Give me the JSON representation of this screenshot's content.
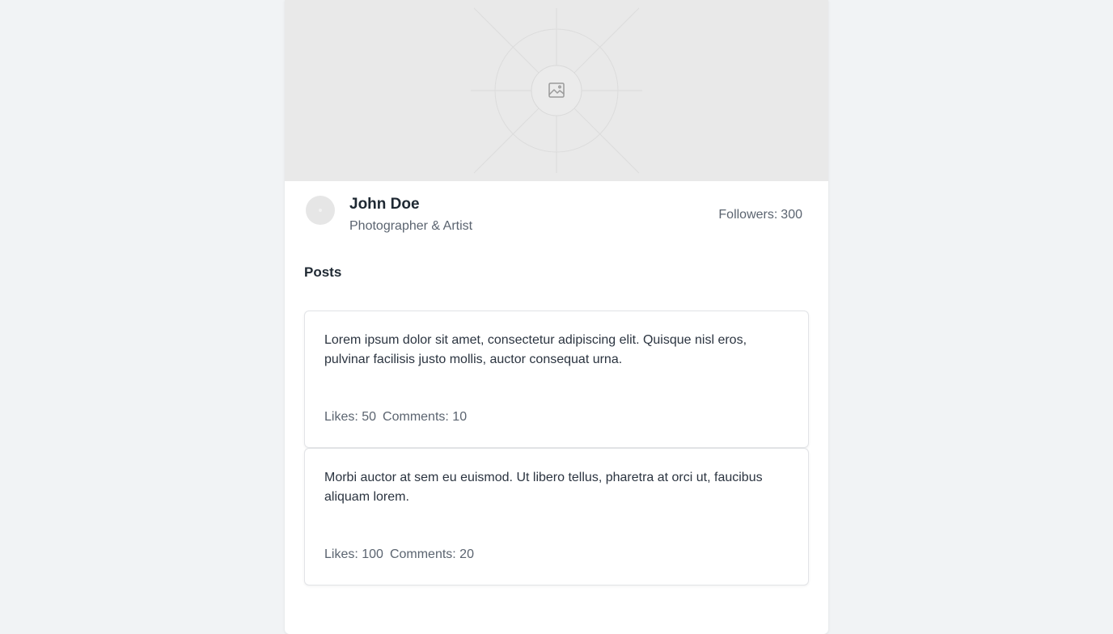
{
  "profile": {
    "name": "John Doe",
    "bio": "Photographer & Artist",
    "followers_label": "Followers:",
    "followers_count": "300"
  },
  "posts_section": {
    "title": "Posts"
  },
  "posts": [
    {
      "text": "Lorem ipsum dolor sit amet, consectetur adipiscing elit. Quisque nisl eros, pulvinar facilisis justo mollis, auctor consequat urna.",
      "likes": "Likes: 50",
      "comments": "Comments: 10"
    },
    {
      "text": "Morbi auctor at sem eu euismod. Ut libero tellus, pharetra at orci ut, faucibus aliquam lorem.",
      "likes": "Likes: 100",
      "comments": "Comments: 20"
    }
  ],
  "icons": {
    "cover": "image-placeholder-icon",
    "avatar": "avatar-placeholder"
  },
  "colors": {
    "page_background": "#f1f3f5",
    "card_background": "#ffffff",
    "cover_background": "#e9e9e9",
    "text_primary": "#1f2933",
    "text_secondary": "#5b6470"
  }
}
